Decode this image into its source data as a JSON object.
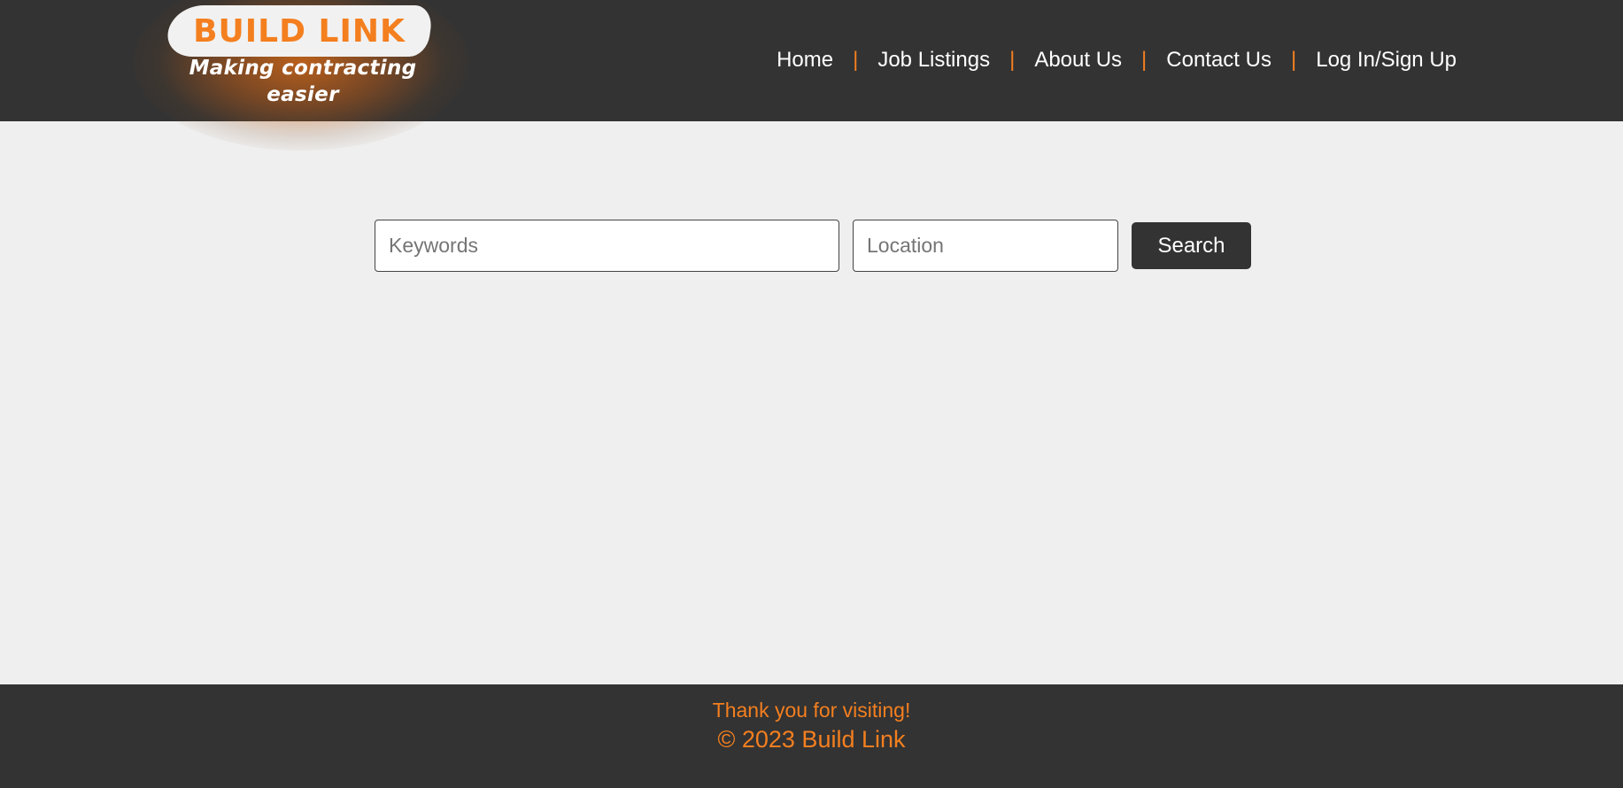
{
  "brand": {
    "name": "BUILD LINK",
    "tagline": "Making contracting easier"
  },
  "nav": {
    "items": [
      {
        "label": "Home"
      },
      {
        "label": "Job Listings"
      },
      {
        "label": "About Us"
      },
      {
        "label": "Contact Us"
      },
      {
        "label": "Log In/Sign Up"
      }
    ],
    "separator": "|"
  },
  "search": {
    "keywords_placeholder": "Keywords",
    "keywords_value": "",
    "location_placeholder": "Location",
    "location_value": "",
    "button_label": "Search"
  },
  "footer": {
    "thanks": "Thank you for visiting!",
    "copyright": "© 2023 Build Link"
  },
  "colors": {
    "header_bg": "#333333",
    "page_bg": "#efefef",
    "accent": "#f47f1f",
    "text_light": "#ffffff"
  }
}
